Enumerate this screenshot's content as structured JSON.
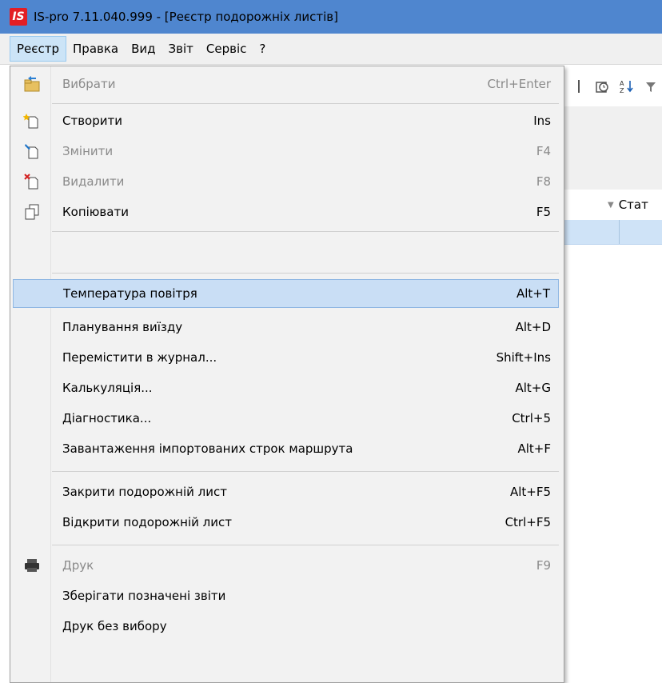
{
  "window": {
    "logo_text": "IS",
    "title": "IS-pro 7.11.040.999 - [Реєстр подорожніх листів]"
  },
  "menubar": {
    "items": [
      "Реєстр",
      "Правка",
      "Вид",
      "Звіт",
      "Сервіс",
      "?"
    ]
  },
  "grid": {
    "visible_header": "Стат"
  },
  "menu": {
    "items": [
      {
        "label": "Вибрати",
        "shortcut": "Ctrl+Enter",
        "icon": "select-folder-icon"
      },
      {
        "label": "Створити",
        "shortcut": "Ins",
        "icon": "new-doc-icon"
      },
      {
        "label": "Змінити",
        "shortcut": "F4",
        "icon": "edit-doc-icon"
      },
      {
        "label": "Видалити",
        "shortcut": "F8",
        "icon": "delete-doc-icon"
      },
      {
        "label": "Копіювати",
        "shortcut": "F5",
        "icon": "copy-icon"
      },
      {
        "label": "Температура повітря",
        "shortcut": "Alt+T"
      },
      {
        "label": "Планування виїзду",
        "shortcut": "Alt+D"
      },
      {
        "label": "Перемістити в журнал...",
        "shortcut": "Shift+Ins"
      },
      {
        "label": "Калькуляція...",
        "shortcut": "Alt+G"
      },
      {
        "label": "Діагностика...",
        "shortcut": "Ctrl+5"
      },
      {
        "label": "Завантаження імпортованих строк маршрута",
        "shortcut": "Alt+F"
      },
      {
        "label": "Закрити подорожній лист",
        "shortcut": "Alt+F5"
      },
      {
        "label": "Відкрити подорожній лист",
        "shortcut": "Ctrl+F5"
      },
      {
        "label": "Друк",
        "shortcut": "F9",
        "icon": "printer-icon"
      },
      {
        "label": "Зберігати позначені звіти",
        "shortcut": ""
      },
      {
        "label": "Друк без вибору",
        "shortcut": ""
      }
    ]
  },
  "colors": {
    "titlebar": "#4f86cf",
    "menu_highlight": "#c9def5",
    "logo": "#e31e24"
  }
}
